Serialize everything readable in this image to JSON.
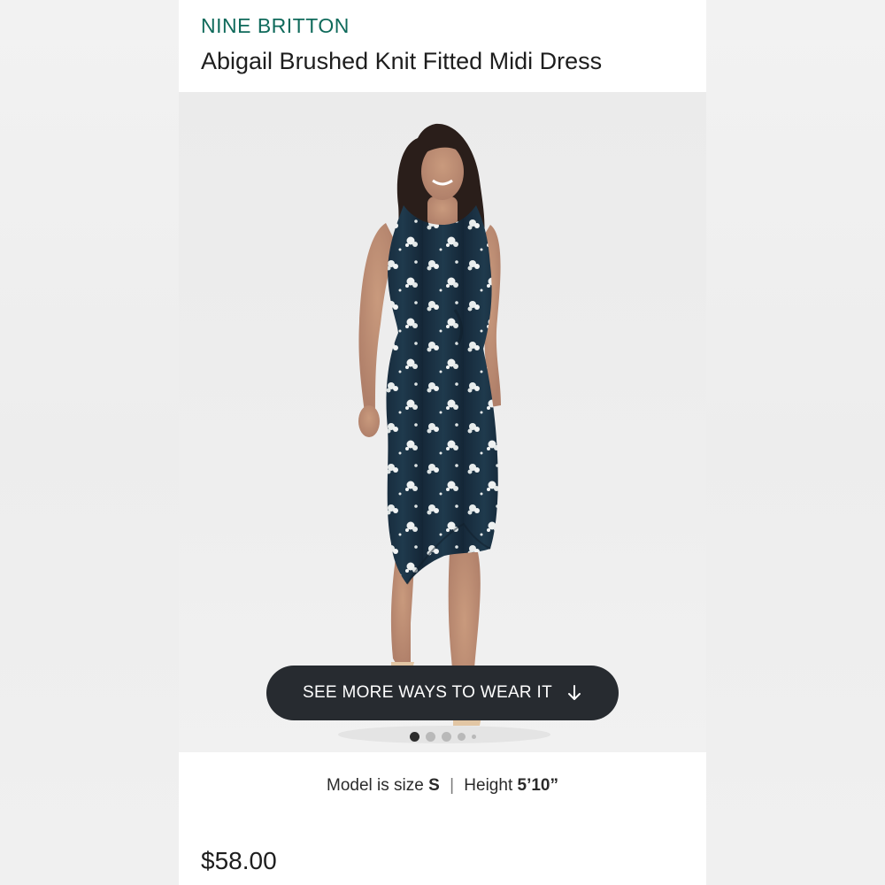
{
  "product": {
    "brand": "NINE BRITTON",
    "title": "Abigail Brushed Knit Fitted Midi Dress",
    "price": "$58.00"
  },
  "gallery": {
    "cta_label": "SEE MORE WAYS TO WEAR IT",
    "cta_icon": "arrow-down-icon",
    "dot_count": 5,
    "active_index": 0
  },
  "fit": {
    "model_size_label": "Model is size",
    "model_size": "S",
    "separator": "|",
    "height_label": "Height",
    "height": "5’10”"
  },
  "colors": {
    "brand": "#0f6a5b",
    "cta_bg": "#272b30",
    "dress": "#1c3344"
  }
}
